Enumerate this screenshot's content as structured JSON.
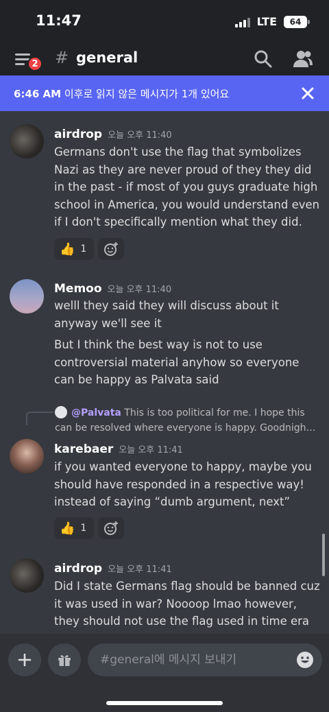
{
  "status": {
    "time": "11:47",
    "network": "LTE",
    "battery": "64"
  },
  "header": {
    "channel": "general",
    "badge": "2"
  },
  "banner": {
    "time": "6:46 AM",
    "text": " 이후로 읽지 않은 메시지가 1개 있어요"
  },
  "messages": [
    {
      "author": "airdrop",
      "timestamp": "오늘 오후 11:40",
      "text": "Germans don't use the flag that symbolizes Nazi as they are never proud of they they did in the past - if most of you guys graduate high school in America, you would understand even if I don't specifically mention what they did.",
      "reaction": {
        "emoji": "👍",
        "count": "1"
      }
    },
    {
      "author": "Memoo",
      "timestamp": "오늘 오후 11:40",
      "text": "welll they said they will discuss about it anyway we'll see it",
      "text2": "But I think the best way is not to use controversial material anyhow so everyone can be happy as Palvata said"
    },
    {
      "reply": {
        "name": "@Palvata",
        "text": "This is too political for me. I hope this can be resolved where everyone is happy. Goodnigh…"
      },
      "author": "karebaer",
      "timestamp": "오늘 오후 11:41",
      "text": "if you wanted everyone to happy, maybe you should have responded in a respective way! instead of saying “dumb argument, next”",
      "reaction": {
        "emoji": "👍",
        "count": "1"
      }
    },
    {
      "author": "airdrop",
      "timestamp": "오늘 오후 11:41",
      "text": "Did I state Germans flag should be banned cuz it was used in war? Noooop lmao however, they should not use the flag used in time era"
    }
  ],
  "composer": {
    "placeholder": "#general에 메시지 보내기"
  },
  "icons": {
    "menu": "hamburger-icon",
    "search": "search-icon",
    "members": "members-icon",
    "close": "close-icon",
    "add_reaction": "add-reaction-icon",
    "plus": "plus-icon",
    "gift": "gift-icon",
    "emoji": "emoji-icon"
  },
  "colors": {
    "blurple": "#5865f2",
    "badge_red": "#ed4245",
    "bg": "#36393f",
    "mention": "#b5a0ff"
  }
}
